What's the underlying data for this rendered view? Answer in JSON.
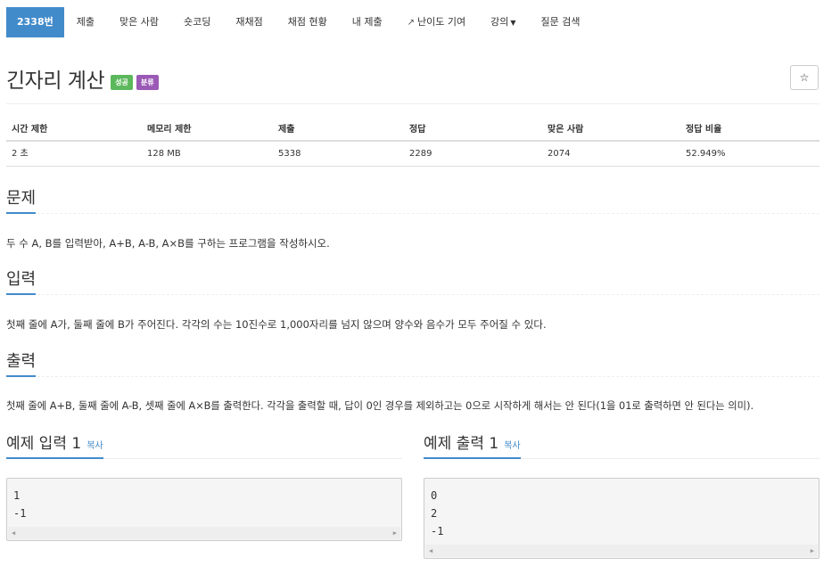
{
  "nav": {
    "items": [
      {
        "label": "2338번",
        "active": true
      },
      {
        "label": "제출"
      },
      {
        "label": "맞은 사람"
      },
      {
        "label": "숏코딩"
      },
      {
        "label": "재채점"
      },
      {
        "label": "채점 현황"
      },
      {
        "label": "내 제출"
      },
      {
        "label": "난이도 기여",
        "icon": "external-link-icon"
      },
      {
        "label": "강의",
        "dropdown": true
      },
      {
        "label": "질문 검색"
      }
    ]
  },
  "problem": {
    "title": "긴자리 계산",
    "badges": {
      "success": "성공",
      "category": "분류"
    },
    "star_icon": "☆"
  },
  "info": {
    "headers": [
      "시간 제한",
      "메모리 제한",
      "제출",
      "정답",
      "맞은 사람",
      "정답 비율"
    ],
    "values": [
      "2 초",
      "128 MB",
      "5338",
      "2289",
      "2074",
      "52.949%"
    ]
  },
  "sections": {
    "problem_heading": "문제",
    "problem_text": "두 수 A, B를 입력받아, A+B, A-B, A×B를 구하는 프로그램을 작성하시오.",
    "input_heading": "입력",
    "input_text": "첫째 줄에 A가, 둘째 줄에 B가 주어진다. 각각의 수는 10진수로 1,000자리를 넘지 않으며 양수와 음수가 모두 주어질 수 있다.",
    "output_heading": "출력",
    "output_text": "첫째 줄에 A+B, 둘째 줄에 A-B, 셋째 줄에 A×B를 출력한다. 각각을 출력할 때, 답이 0인 경우를 제외하고는 0으로 시작하게 해서는 안 된다(1을 01로 출력하면 안 된다는 의미)."
  },
  "samples": {
    "input_heading": "예제 입력 1",
    "output_heading": "예제 출력 1",
    "copy_label": "복사",
    "input_value": "1\n-1",
    "output_value": "0\n2\n-1"
  },
  "colors": {
    "primary": "#428bca",
    "success": "#5cb85c",
    "purple": "#9b59b6"
  }
}
